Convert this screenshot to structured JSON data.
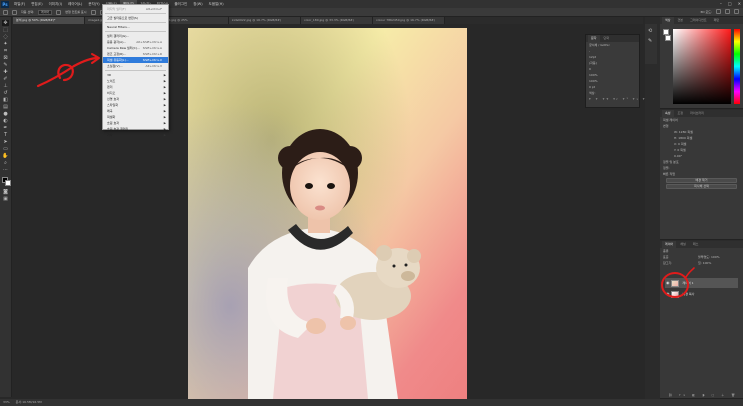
{
  "menubar": {
    "logo": "Ps",
    "items": [
      "파일(F)",
      "편집(E)",
      "이미지(I)",
      "레이어(L)",
      "문자(Y)",
      "선택(S)",
      "필터(T)",
      "3D(D)",
      "보기(V)",
      "플러그인",
      "창(W)",
      "도움말(H)"
    ],
    "active_index": 6,
    "window_controls": [
      "–",
      "□",
      "✕"
    ]
  },
  "options": {
    "auto_select": "자동 선택:",
    "layer_value": "레이어",
    "transform_label": "변형 컨트롤 표시",
    "mode_3d": "3D 모드:"
  },
  "tabs": [
    {
      "label": "분석.jpg @ 50% (RGB/8#)*",
      "active": true
    },
    {
      "label": "image2.jpg @ 33.3% (RGB/8)",
      "active": false
    },
    {
      "label": "photo4.jpg @ 25%",
      "active": false
    },
    {
      "label": "kids0022.jpg @ 16.7% (RGB/8#)",
      "active": false
    },
    {
      "label": "color_180.jpg @ 33.3% (RGB/8#)",
      "active": false
    },
    {
      "label": "colour 7862450.jpg @ 16.7% (RGB/8#)",
      "active": false
    }
  ],
  "filter_menu": {
    "items": [
      {
        "label": "마지막 필터(F)",
        "shortcut": "Alt+Ctrl+F",
        "disabled": true
      },
      {
        "type": "sep"
      },
      {
        "label": "고급 필터용으로 변환(S)"
      },
      {
        "type": "sep"
      },
      {
        "label": "Neural Filters..."
      },
      {
        "type": "sep"
      },
      {
        "label": "필터 갤러리(G)..."
      },
      {
        "label": "응용 광각(A)...",
        "shortcut": "Alt+Shift+Ctrl+A"
      },
      {
        "label": "Camera Raw 필터(C)...",
        "shortcut": "Shift+Ctrl+A"
      },
      {
        "label": "렌즈 교정(R)...",
        "shortcut": "Shift+Ctrl+R"
      },
      {
        "label": "픽셀 유동화(L)...",
        "shortcut": "Shift+Ctrl+X",
        "highlight": true
      },
      {
        "label": "소실점(V)...",
        "shortcut": "Alt+Ctrl+V"
      },
      {
        "type": "sep"
      },
      {
        "label": "3D",
        "submenu": true
      },
      {
        "label": "노이즈",
        "submenu": true
      },
      {
        "label": "렌더",
        "submenu": true
      },
      {
        "label": "비디오",
        "submenu": true
      },
      {
        "label": "선명 효과",
        "submenu": true
      },
      {
        "label": "스타일화",
        "submenu": true
      },
      {
        "label": "왜곡",
        "submenu": true
      },
      {
        "label": "픽셀화",
        "submenu": true
      },
      {
        "label": "흐림 효과",
        "submenu": true
      },
      {
        "label": "흐림 효과 갤러리",
        "submenu": true
      },
      {
        "label": "기타",
        "submenu": true
      }
    ]
  },
  "float_panel": {
    "tabs": [
      "문자",
      "단락"
    ],
    "font": "궁서체 / Gothic",
    "style": "-",
    "size": "12pt",
    "leading": "(자동)",
    "tracking": "0",
    "scale_v": "100%",
    "scale_h": "100%",
    "baseline": "0 pt",
    "color_label": "색상:"
  },
  "color_panel": {
    "tabs": [
      "색상",
      "견본",
      "그레이디언트",
      "패턴"
    ]
  },
  "properties": {
    "tabs": [
      "속성",
      "조정",
      "라이브러리"
    ],
    "header": "픽셀 레이어",
    "transform_title": "변형",
    "w": "W: 1280 픽셀",
    "h": "H: 1800 픽셀",
    "x": "X: 0 픽셀",
    "y": "Y: 0 픽셀",
    "angle": "0.00°",
    "align_title": "정렬 및 분포",
    "align_label": "정렬:",
    "quick_title": "빠른 작업",
    "btn1": "배경 제거",
    "btn2": "피사체 선택"
  },
  "layers": {
    "tabs": [
      "레이어",
      "채널",
      "패스"
    ],
    "kind": "종류",
    "mode": "표준",
    "opacity": "불투명도: 100%",
    "lock": "잠그기:",
    "fill": "칠: 100%",
    "rows": [
      {
        "name": "레이어 1",
        "selected": true
      },
      {
        "name": "배경 복사",
        "selected": false
      }
    ]
  },
  "status": {
    "zoom": "33%",
    "doc": "문서:16.5M/16.5M"
  },
  "colors": {
    "highlight": "#2f7bdb",
    "annotation": "#e01b1b"
  }
}
